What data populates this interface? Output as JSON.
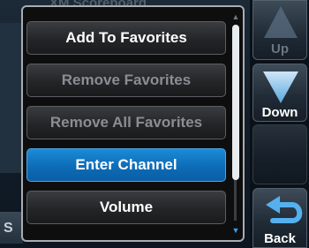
{
  "background": {
    "title": "XM Scoreboard",
    "left_button_letter": "S"
  },
  "menu": {
    "items": [
      {
        "label": "Add To Favorites",
        "state": "enabled"
      },
      {
        "label": "Remove Favorites",
        "state": "disabled"
      },
      {
        "label": "Remove All Favorites",
        "state": "disabled"
      },
      {
        "label": "Enter Channel",
        "state": "selected"
      },
      {
        "label": "Volume",
        "state": "enabled"
      }
    ]
  },
  "side_buttons": {
    "up": {
      "label": "Up",
      "icon": "triangle-up-icon",
      "enabled": false
    },
    "down": {
      "label": "Down",
      "icon": "triangle-down-icon",
      "enabled": true
    },
    "back": {
      "label": "Back",
      "icon": "back-arrow-icon",
      "enabled": true
    }
  },
  "colors": {
    "selected": "#1478c8",
    "icon_blue": "#4aa3e0",
    "disabled_text": "#8a8e92"
  }
}
